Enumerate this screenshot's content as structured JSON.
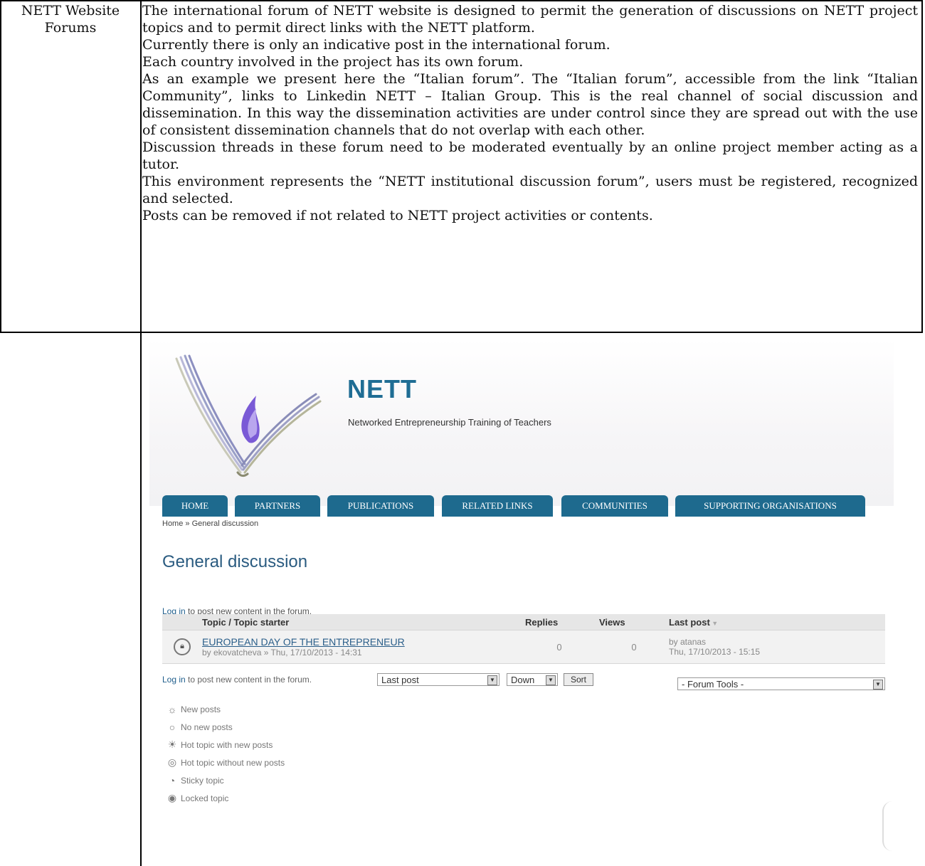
{
  "row1": {
    "label": "NETT Website Forums",
    "paragraphs": [
      "The international forum of NETT website is designed to permit the generation of discussions on NETT project topics and to permit direct links with the NETT platform.",
      "Currently there is only an indicative post in the international forum.",
      "Each country involved in the project has its own forum.",
      "As an example we present here the “Italian forum”. The “Italian forum”, accessible from the link “Italian Community”, links to Linkedin NETT – Italian Group. This is the real channel of social discussion and dissemination. In this way  the dissemination activities are under control since they are spread out with the use of consistent dissemination channels that do not overlap with each other.",
      "Discussion threads in these forum need to be moderated eventually by an online project member acting as a tutor.",
      "This environment represents the “NETT institutional discussion forum”, users must be registered, recognized and selected.",
      "Posts can be removed if not related to NETT project activities or contents."
    ]
  },
  "site": {
    "title": "NETT",
    "subtitle": "Networked Entrepreneurship Training of Teachers",
    "nav": [
      "HOME",
      "PARTNERS",
      "PUBLICATIONS",
      "RELATED LINKS",
      "COMMUNITIES",
      "SUPPORTING ORGANISATIONS"
    ],
    "breadcrumb": "Home » General discussion",
    "page_title": "General discussion",
    "login_link": "Log in",
    "login_rest": " to post new content in the forum.",
    "table": {
      "headers": {
        "topic": "Topic / Topic starter",
        "replies": "Replies",
        "views": "Views",
        "last_post": "Last post"
      },
      "rows": [
        {
          "title": "EUROPEAN DAY OF THE ENTREPRENEUR",
          "meta": "by ekovatcheva » Thu, 17/10/2013 - 14:31",
          "replies": "0",
          "views": "0",
          "last_by": "by atanas",
          "last_date": "Thu, 17/10/2013 - 15:15"
        }
      ]
    },
    "sort": {
      "field": "Last post",
      "order": "Down",
      "button": "Sort",
      "tools": "- Forum Tools -"
    },
    "legend": [
      "New posts",
      "No new posts",
      "Hot topic with new posts",
      "Hot topic without new posts",
      "Sticky topic",
      "Locked topic"
    ]
  }
}
